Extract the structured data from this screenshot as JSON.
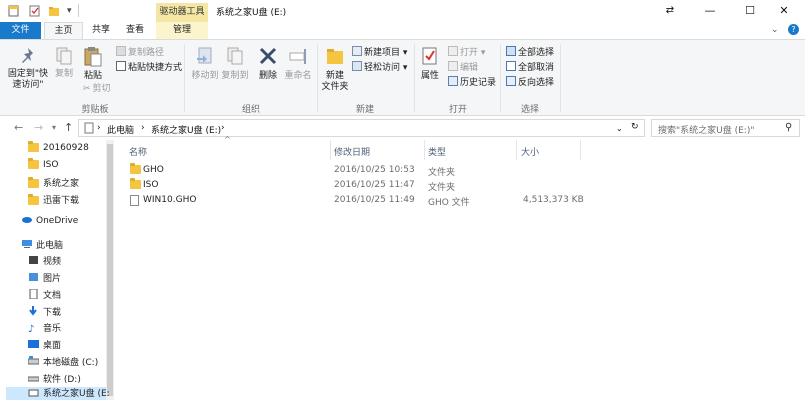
{
  "window": {
    "title": "系统之家U盘 (E:)",
    "context_tab": "驱动器工具",
    "minimize": "—",
    "maximize": "☐",
    "close": "✕",
    "expand": "⇄"
  },
  "tabs": {
    "file": "文件",
    "home": "主页",
    "share": "共享",
    "view": "查看",
    "manage": "管理"
  },
  "ribbon": {
    "clipboard": {
      "label": "剪贴板",
      "pin": "固定到\"快\n速访问\"",
      "copy": "复制",
      "paste": "粘贴",
      "copy_path": "复制路径",
      "paste_shortcut": "粘贴快捷方式",
      "cut": "剪切"
    },
    "organize": {
      "label": "组织",
      "move_to": "移动到",
      "copy_to": "复制到",
      "delete": "删除",
      "rename": "重命名"
    },
    "new": {
      "label": "新建",
      "new_folder": "新建\n文件夹",
      "new_item": "新建项目",
      "easy_access": "轻松访问"
    },
    "open": {
      "label": "打开",
      "properties": "属性",
      "open": "打开",
      "edit": "编辑",
      "history": "历史记录"
    },
    "select": {
      "label": "选择",
      "select_all": "全部选择",
      "select_none": "全部取消",
      "invert": "反向选择"
    }
  },
  "address": {
    "breadcrumbs": [
      "此电脑",
      "系统之家U盘 (E:)"
    ],
    "search_placeholder": "搜索\"系统之家U盘 (E:)\""
  },
  "nav": {
    "items": [
      {
        "label": "20160928",
        "icon": "folder-icon"
      },
      {
        "label": "ISO",
        "icon": "folder-icon"
      },
      {
        "label": "系统之家",
        "icon": "folder-icon"
      },
      {
        "label": "迅雷下载",
        "icon": "folder-icon"
      },
      {
        "label": "OneDrive",
        "icon": "cloud-icon"
      },
      {
        "label": "此电脑",
        "icon": "computer-icon"
      },
      {
        "label": "视频",
        "icon": "video-icon"
      },
      {
        "label": "图片",
        "icon": "pictures-icon"
      },
      {
        "label": "文档",
        "icon": "documents-icon"
      },
      {
        "label": "下载",
        "icon": "download-icon"
      },
      {
        "label": "音乐",
        "icon": "music-icon"
      },
      {
        "label": "桌面",
        "icon": "desktop-icon"
      },
      {
        "label": "本地磁盘 (C:)",
        "icon": "drive-icon"
      },
      {
        "label": "软件 (D:)",
        "icon": "drive-icon"
      },
      {
        "label": "系统之家U盘 (E:",
        "icon": "usb-drive-icon"
      }
    ]
  },
  "columns": {
    "name": "名称",
    "date": "修改日期",
    "type": "类型",
    "size": "大小"
  },
  "files": [
    {
      "name": "GHO",
      "date": "2016/10/25 10:53",
      "type": "文件夹",
      "size": "",
      "kind": "folder"
    },
    {
      "name": "ISO",
      "date": "2016/10/25 11:47",
      "type": "文件夹",
      "size": "",
      "kind": "folder"
    },
    {
      "name": "WIN10.GHO",
      "date": "2016/10/25 11:49",
      "type": "GHO 文件",
      "size": "4,513,373 KB",
      "kind": "file"
    }
  ]
}
